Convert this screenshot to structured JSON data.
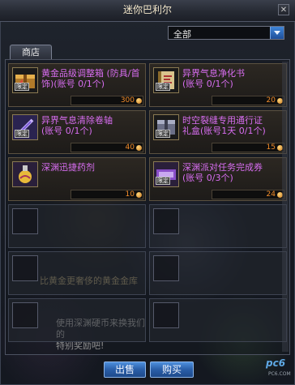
{
  "window": {
    "title": "迷你巴利尔",
    "close_icon": "close-icon"
  },
  "filter": {
    "selected": "全部"
  },
  "tabs": [
    {
      "label": "商店",
      "active": true
    }
  ],
  "colors": {
    "item_name": "#d76df0",
    "price": "#f28c2a",
    "button": "#2a5ea8"
  },
  "items": [
    {
      "name": "黄金品级调整箱 (防具/首饰)(账号 0/1个)",
      "price": "300",
      "icon": "golden-box-icon",
      "locked": true,
      "lock_label": "限定"
    },
    {
      "name": "异界气息净化书\n(账号 0/1个)",
      "price": "20",
      "icon": "purify-book-icon",
      "locked": true,
      "lock_label": "限定"
    },
    {
      "name": "异界气息清除卷轴\n(账号 0/1个)",
      "price": "40",
      "icon": "scroll-icon",
      "locked": true,
      "lock_label": "限定"
    },
    {
      "name": "时空裂缝专用通行证\n礼盒(账号1天 0/1个)",
      "price": "15",
      "icon": "pass-box-icon",
      "locked": true,
      "lock_label": "限定"
    },
    {
      "name": "深渊迅捷药剂",
      "price": "10",
      "icon": "potion-icon",
      "locked": false,
      "lock_label": ""
    },
    {
      "name": "深渊派对任务完成券\n(账号 0/3个)",
      "price": "24",
      "icon": "ticket-icon",
      "locked": true,
      "lock_label": "限定"
    }
  ],
  "background_text": {
    "line1": "比黄金更奢侈的黄金金库",
    "line2": "使用深渊硬币来换我们的\n特别奖励吧!"
  },
  "buttons": {
    "sell": "出售",
    "buy": "购买"
  },
  "watermark": {
    "text": "pc6",
    "sub": "PC6.COM"
  }
}
